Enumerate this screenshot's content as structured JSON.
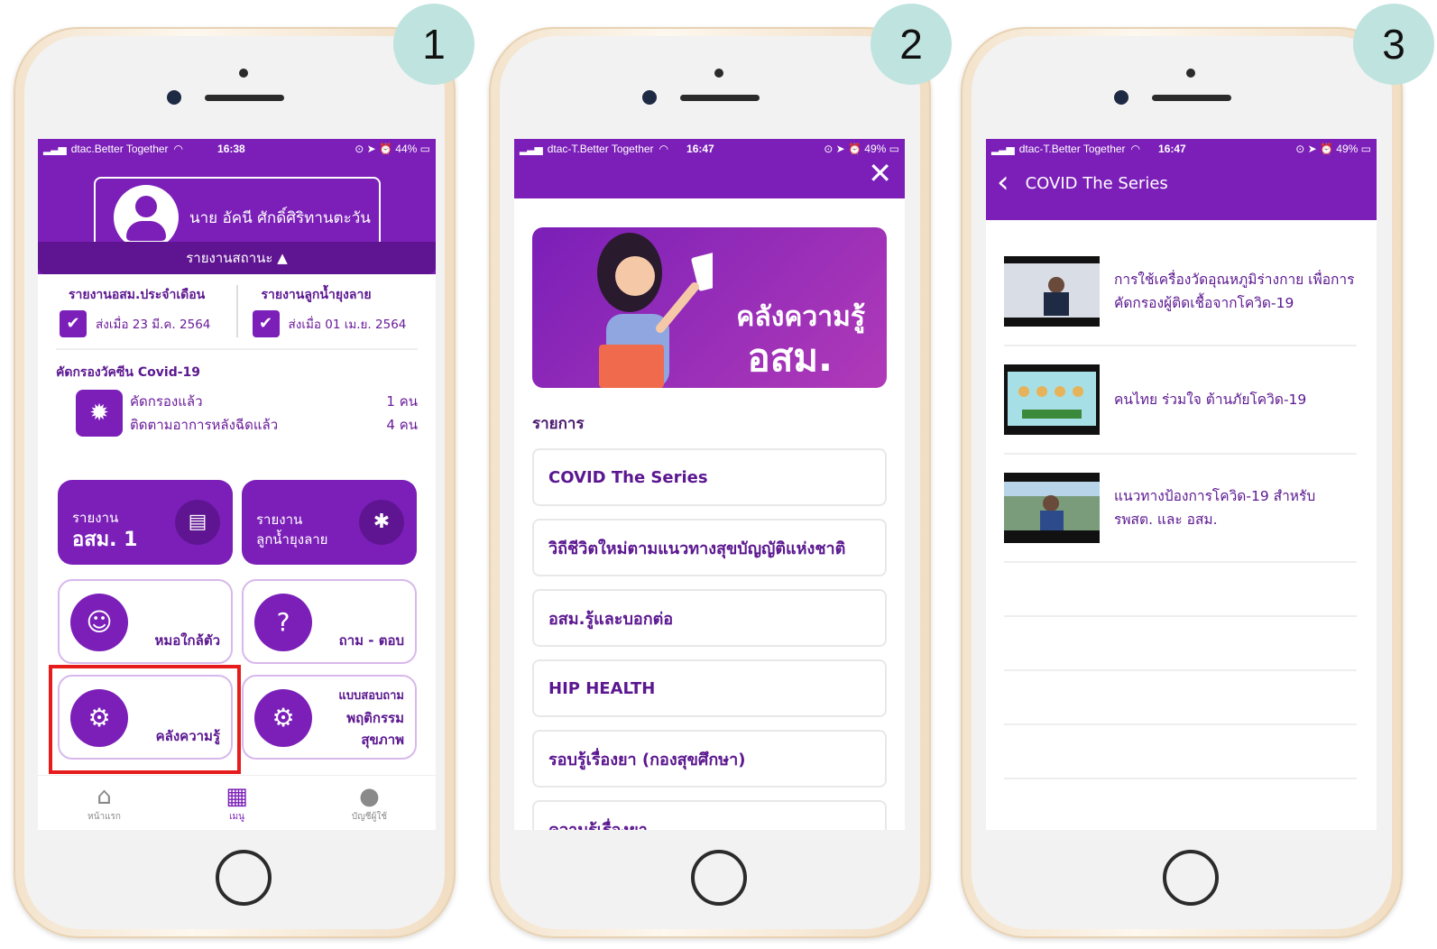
{
  "steps": [
    "1",
    "2",
    "3"
  ],
  "phone1": {
    "status": {
      "carrier": "dtac.Better Together",
      "time": "16:38",
      "battery": "44%"
    },
    "user_name": "นาย อัคนี ศักดิ์ศิริทานตะวัน",
    "status_toggle": "รายงานสถานะ ▲",
    "monthly_report": {
      "title": "รายงานอสม.ประจำเดือน",
      "sent": "ส่งเมื่อ 23 มี.ค. 2564"
    },
    "larva_report": {
      "title": "รายงานลูกน้ำยุงลาย",
      "sent": "ส่งเมื่อ 01 เม.ย. 2564"
    },
    "covid": {
      "title": "คัดกรองวัคซีน Covid-19",
      "screened_label": "คัดกรองแล้ว",
      "screened_value": "1 คน",
      "followed_label": "ติดตามอาการหลังฉีดแล้ว",
      "followed_value": "4 คน"
    },
    "tiles": {
      "report1_small": "รายงาน",
      "report1_big": "อสม. 1",
      "report2_small": "รายงาน",
      "report2_big": "ลูกน้ำยุงลาย",
      "doctor": "หมอใกล้ตัว",
      "qa": "ถาม - ตอบ",
      "knowledge": "คลังความรู้",
      "survey_l1": "แบบสอบถาม",
      "survey_l2": "พฤติกรรม",
      "survey_l3": "สุขภาพ"
    },
    "tabbar": {
      "home": "หน้าแรก",
      "menu": "เมนู",
      "account": "บัญชีผู้ใช้"
    }
  },
  "phone2": {
    "status": {
      "carrier": "dtac-T.Better Together",
      "time": "16:47",
      "battery": "49%"
    },
    "banner_line1": "คลังความรู้",
    "banner_line2": "อสม.",
    "section": "รายการ",
    "items": [
      "COVID The Series",
      "วิถีชีวิตใหม่ตามแนวทางสุขบัญญัติแห่งชาติ",
      "อสม.รู้และบอกต่อ",
      "HIP HEALTH",
      "รอบรู้เรื่องยา (กองสุขศึกษา)",
      "ความรู้เรื่องยา"
    ]
  },
  "phone3": {
    "status": {
      "carrier": "dtac-T.Better Together",
      "time": "16:47",
      "battery": "49%"
    },
    "title": "COVID The Series",
    "videos": [
      "การใช้เครื่องวัดอุณหภูมิร่างกาย เพื่อการคัดกรองผู้ติดเชื้อจากโควิด-19",
      "คนไทย ร่วมใจ ต้านภัยโควิด-19",
      "แนวทางป้องการโควิด-19 สำหรับ รพสต. และ อสม."
    ]
  }
}
